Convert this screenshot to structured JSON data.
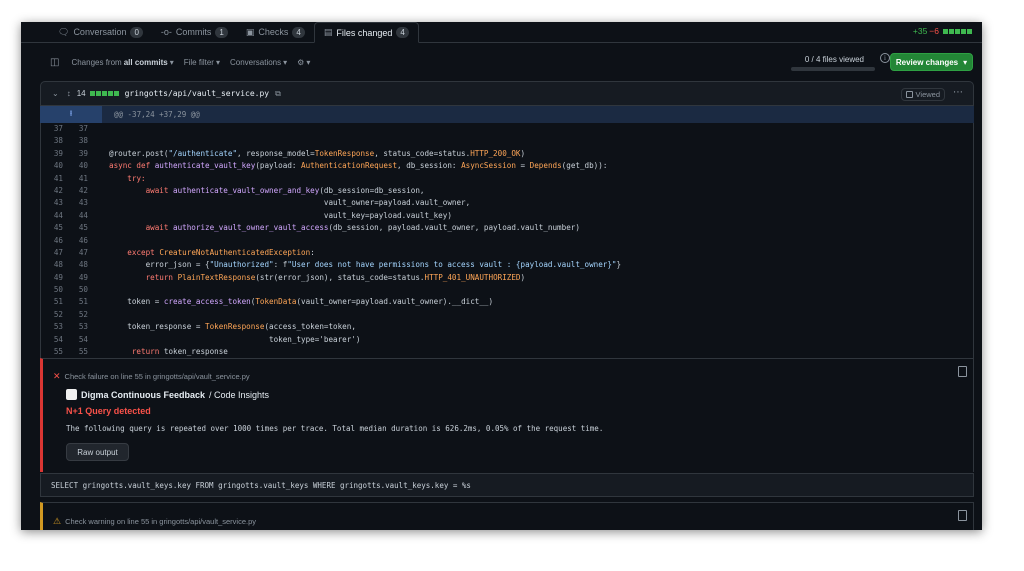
{
  "tabs": [
    {
      "icon": "conversation-icon",
      "label": "Conversation",
      "count": "0"
    },
    {
      "icon": "commits-icon",
      "label": "Commits",
      "count": "1"
    },
    {
      "icon": "checks-icon",
      "label": "Checks",
      "count": "4"
    },
    {
      "icon": "files-changed-icon",
      "label": "Files changed",
      "count": "4",
      "active": true
    }
  ],
  "diffstat": {
    "additions": "+35",
    "deletions": "−6"
  },
  "toolbar": {
    "changes_prefix": "Changes from",
    "changes_value": "all commits",
    "file_filter": "File filter",
    "conversations": "Conversations",
    "files_viewed": "0 / 4 files viewed",
    "review_button": "Review changes"
  },
  "file": {
    "changed_lines": "14",
    "path": "gringotts/api/vault_service.py",
    "viewed_label": "Viewed"
  },
  "hunk_header": "@@ -37,24 +37,29 @@",
  "code_lines": [
    {
      "old": "37",
      "new": "37",
      "text": ""
    },
    {
      "old": "38",
      "new": "38",
      "text": ""
    },
    {
      "old": "39",
      "new": "39",
      "text": "@router.post(\"/authenticate\", response_model=TokenResponse, status_code=status.HTTP_200_OK)"
    },
    {
      "old": "40",
      "new": "40",
      "text": "async def authenticate_vault_key(payload: AuthenticationRequest, db_session: AsyncSession = Depends(get_db)):"
    },
    {
      "old": "41",
      "new": "41",
      "text": "    try:"
    },
    {
      "old": "42",
      "new": "42",
      "text": "        await authenticate_vault_owner_and_key(db_session=db_session,"
    },
    {
      "old": "43",
      "new": "43",
      "text": "                                               vault_owner=payload.vault_owner,"
    },
    {
      "old": "44",
      "new": "44",
      "text": "                                               vault_key=payload.vault_key)"
    },
    {
      "old": "45",
      "new": "45",
      "text": "        await authorize_vault_owner_vault_access(db_session, payload.vault_owner, payload.vault_number)"
    },
    {
      "old": "46",
      "new": "46",
      "text": ""
    },
    {
      "old": "47",
      "new": "47",
      "text": "    except CreatureNotAuthenticatedException:"
    },
    {
      "old": "48",
      "new": "48",
      "text": "        error_json = {\"Unauthorized\": f\"User does not have permissions to access vault : {payload.vault_owner}\"}"
    },
    {
      "old": "49",
      "new": "49",
      "text": "        return PlainTextResponse(str(error_json), status_code=status.HTTP_401_UNAUTHORIZED)"
    },
    {
      "old": "50",
      "new": "50",
      "text": ""
    },
    {
      "old": "51",
      "new": "51",
      "text": "    token = create_access_token(TokenData(vault_owner=payload.vault_owner).__dict__)"
    },
    {
      "old": "52",
      "new": "52",
      "text": ""
    },
    {
      "old": "53",
      "new": "53",
      "text": "    token_response = TokenResponse(access_token=token,"
    },
    {
      "old": "54",
      "new": "54",
      "text": "                                   token_type='bearer')"
    },
    {
      "old": "55",
      "new": "55",
      "text": "     return token_response"
    }
  ],
  "check_failure": {
    "heading": "Check failure on line 55 in gringotts/api/vault_service.py",
    "app_name": "Digma Continuous Feedback",
    "app_suffix": "/ Code Insights",
    "title": "N+1 Query detected",
    "description": "The following query is repeated over 1000 times per trace. Total median duration is 626.2ms, 0.05% of the request time.",
    "raw_button": "Raw output"
  },
  "sql_query": "SELECT gringotts.vault_keys.key FROM gringotts.vault_keys WHERE gringotts.vault_keys.key = %s",
  "check_warning": {
    "heading": "Check warning on line 55 in gringotts/api/vault_service.py"
  },
  "colors": {
    "accent_green": "#238636",
    "failure_red": "#f85149",
    "warning_yellow": "#d29922",
    "background": "#0d1117"
  }
}
